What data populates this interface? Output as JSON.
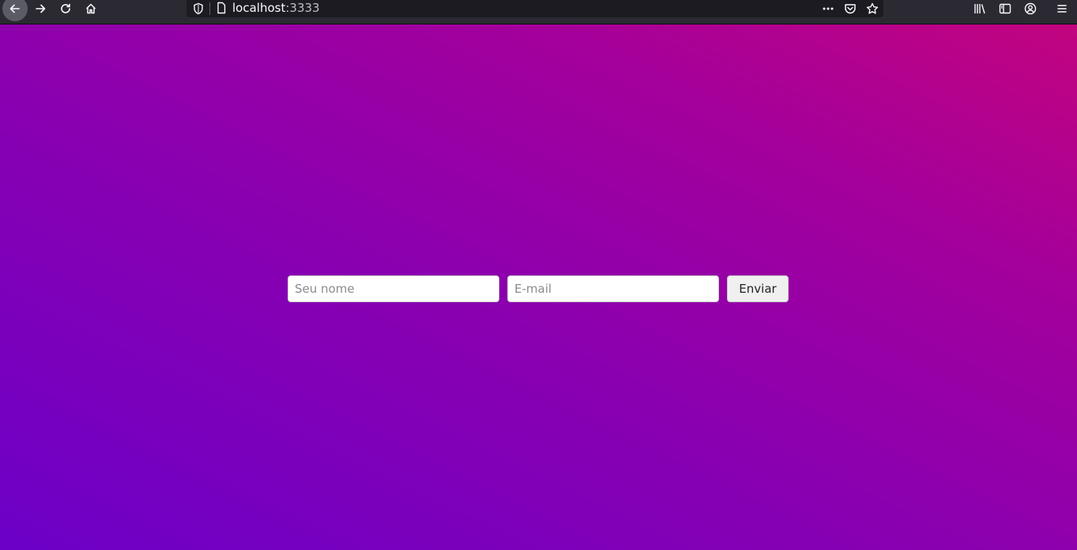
{
  "browser": {
    "url_host": "localhost",
    "url_port": ":3333",
    "toolbar_icons": [
      "back-arrow-icon",
      "forward-arrow-icon",
      "reload-icon",
      "home-icon",
      "shield-icon",
      "page-icon",
      "more-icon",
      "pocket-icon",
      "star-icon",
      "library-icon",
      "sidebar-icon",
      "account-icon",
      "menu-icon"
    ]
  },
  "form": {
    "name_placeholder": "Seu nome",
    "name_value": "",
    "email_placeholder": "E-mail",
    "email_value": "",
    "submit_label": "Enviar"
  },
  "colors": {
    "gradient_start": "#6c00c7",
    "gradient_end": "#c2047f",
    "toolbar": "#2b2a33",
    "urlbar": "#1c1b22"
  }
}
